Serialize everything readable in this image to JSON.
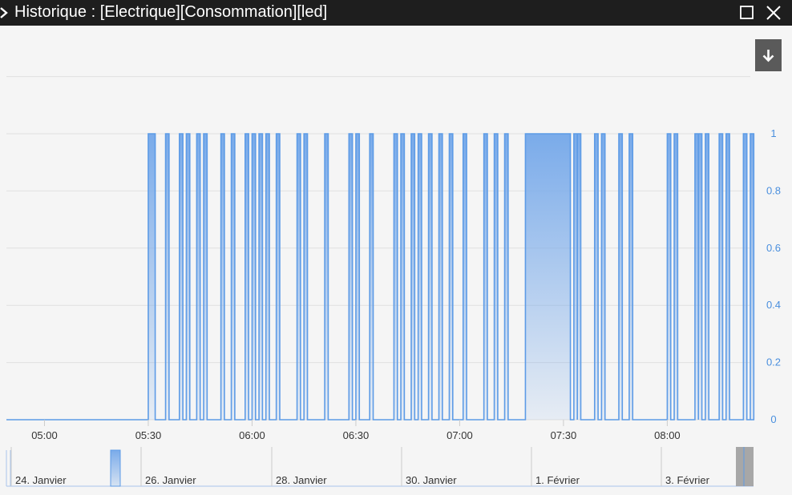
{
  "window": {
    "title": "Historique : [Electrique][Consommation][led]",
    "icons": {
      "expand": "chevron-right-icon",
      "maximize": "maximize-icon",
      "close": "close-icon",
      "export": "download-arrow-icon"
    }
  },
  "colors": {
    "series": "#7aabea",
    "series_line": "#5d9be6",
    "grid": "#e0e0e0",
    "axis_text": "#333333",
    "y_text": "#4a8fde",
    "titlebar": "#1e1e1e",
    "background": "#f5f5f5"
  },
  "chart_data": {
    "type": "area",
    "step": true,
    "x_unit": "time (HH:MM)",
    "xlim": [
      "04:49",
      "08:24"
    ],
    "ylim": [
      0,
      1
    ],
    "x_ticks": [
      "05:00",
      "05:30",
      "06:00",
      "06:30",
      "07:00",
      "07:30",
      "08:00"
    ],
    "y_ticks": [
      "0",
      "0.2",
      "0.4",
      "0.6",
      "0.8",
      "1"
    ],
    "grid": true,
    "legend": "none",
    "series": [
      {
        "on_intervals": [
          [
            "05:30",
            "05:32"
          ],
          [
            "05:35",
            "05:36"
          ],
          [
            "05:39",
            "05:40"
          ],
          [
            "05:41",
            "05:42"
          ],
          [
            "05:44",
            "05:45"
          ],
          [
            "05:46",
            "05:47"
          ],
          [
            "05:51",
            "05:52"
          ],
          [
            "05:54",
            "05:55"
          ],
          [
            "05:58",
            "05:59"
          ],
          [
            "06:00",
            "06:01"
          ],
          [
            "06:02",
            "06:03"
          ],
          [
            "06:04",
            "06:05"
          ],
          [
            "06:07",
            "06:08"
          ],
          [
            "06:13",
            "06:14"
          ],
          [
            "06:15",
            "06:16"
          ],
          [
            "06:21",
            "06:22"
          ],
          [
            "06:28",
            "06:29"
          ],
          [
            "06:30",
            "06:31"
          ],
          [
            "06:34",
            "06:35"
          ],
          [
            "06:41",
            "06:42"
          ],
          [
            "06:43",
            "06:44"
          ],
          [
            "06:46",
            "06:47"
          ],
          [
            "06:48",
            "06:49"
          ],
          [
            "06:51",
            "06:52"
          ],
          [
            "06:54",
            "06:55"
          ],
          [
            "06:57",
            "06:58"
          ],
          [
            "07:01",
            "07:02"
          ],
          [
            "07:07",
            "07:08"
          ],
          [
            "07:10",
            "07:11"
          ],
          [
            "07:13",
            "07:14"
          ],
          [
            "07:19",
            "07:32"
          ],
          [
            "07:33",
            "07:34"
          ],
          [
            "07:34",
            "07:35"
          ],
          [
            "07:39",
            "07:40"
          ],
          [
            "07:41",
            "07:42"
          ],
          [
            "07:46",
            "07:47"
          ],
          [
            "07:49",
            "07:50"
          ],
          [
            "08:00",
            "08:01"
          ],
          [
            "08:02",
            "08:03"
          ],
          [
            "08:08",
            "08:09"
          ],
          [
            "08:09",
            "08:10"
          ],
          [
            "08:11",
            "08:12"
          ],
          [
            "08:15",
            "08:16"
          ],
          [
            "08:17",
            "08:18"
          ],
          [
            "08:22",
            "08:23"
          ],
          [
            "08:24",
            "08:25"
          ]
        ]
      }
    ]
  },
  "navigator": {
    "labels": [
      "24. Janvier",
      "26. Janvier",
      "28. Janvier",
      "30. Janvier",
      "1. Février",
      "3. Février"
    ]
  }
}
